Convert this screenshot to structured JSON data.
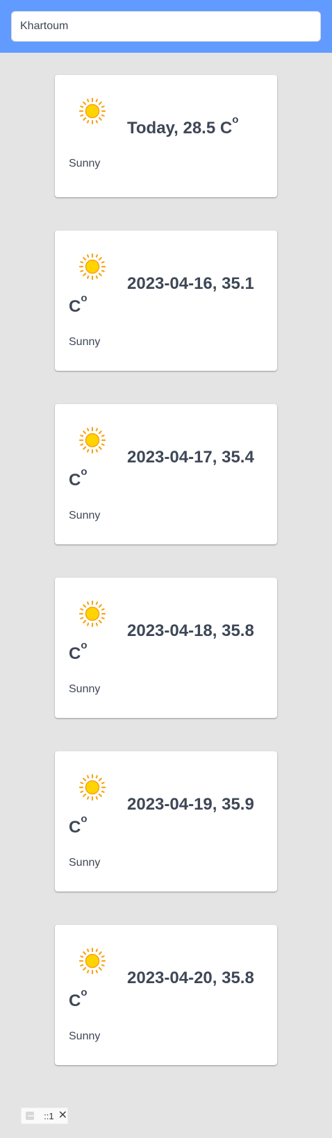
{
  "search": {
    "value": "Khartoum"
  },
  "forecast": [
    {
      "label": "Today",
      "temp": "28.5",
      "unit": "C",
      "degree": "o",
      "condition": "Sunny",
      "icon": "sun-icon"
    },
    {
      "label": "2023-04-16",
      "temp": "35.1",
      "unit": "C",
      "degree": "o",
      "condition": "Sunny",
      "icon": "sun-icon"
    },
    {
      "label": "2023-04-17",
      "temp": "35.4",
      "unit": "C",
      "degree": "o",
      "condition": "Sunny",
      "icon": "sun-icon"
    },
    {
      "label": "2023-04-18",
      "temp": "35.8",
      "unit": "C",
      "degree": "o",
      "condition": "Sunny",
      "icon": "sun-icon"
    },
    {
      "label": "2023-04-19",
      "temp": "35.9",
      "unit": "C",
      "degree": "o",
      "condition": "Sunny",
      "icon": "sun-icon"
    },
    {
      "label": "2023-04-20",
      "temp": "35.8",
      "unit": "C",
      "degree": "o",
      "condition": "Sunny",
      "icon": "sun-icon"
    }
  ],
  "status_chip": {
    "label": "::1",
    "close_glyph": "✕"
  },
  "colors": {
    "header": "#619bff",
    "background": "#e4e4e4",
    "text": "#3e4756",
    "sun_core": "#ffd400",
    "sun_rays": "#f7a51c"
  }
}
